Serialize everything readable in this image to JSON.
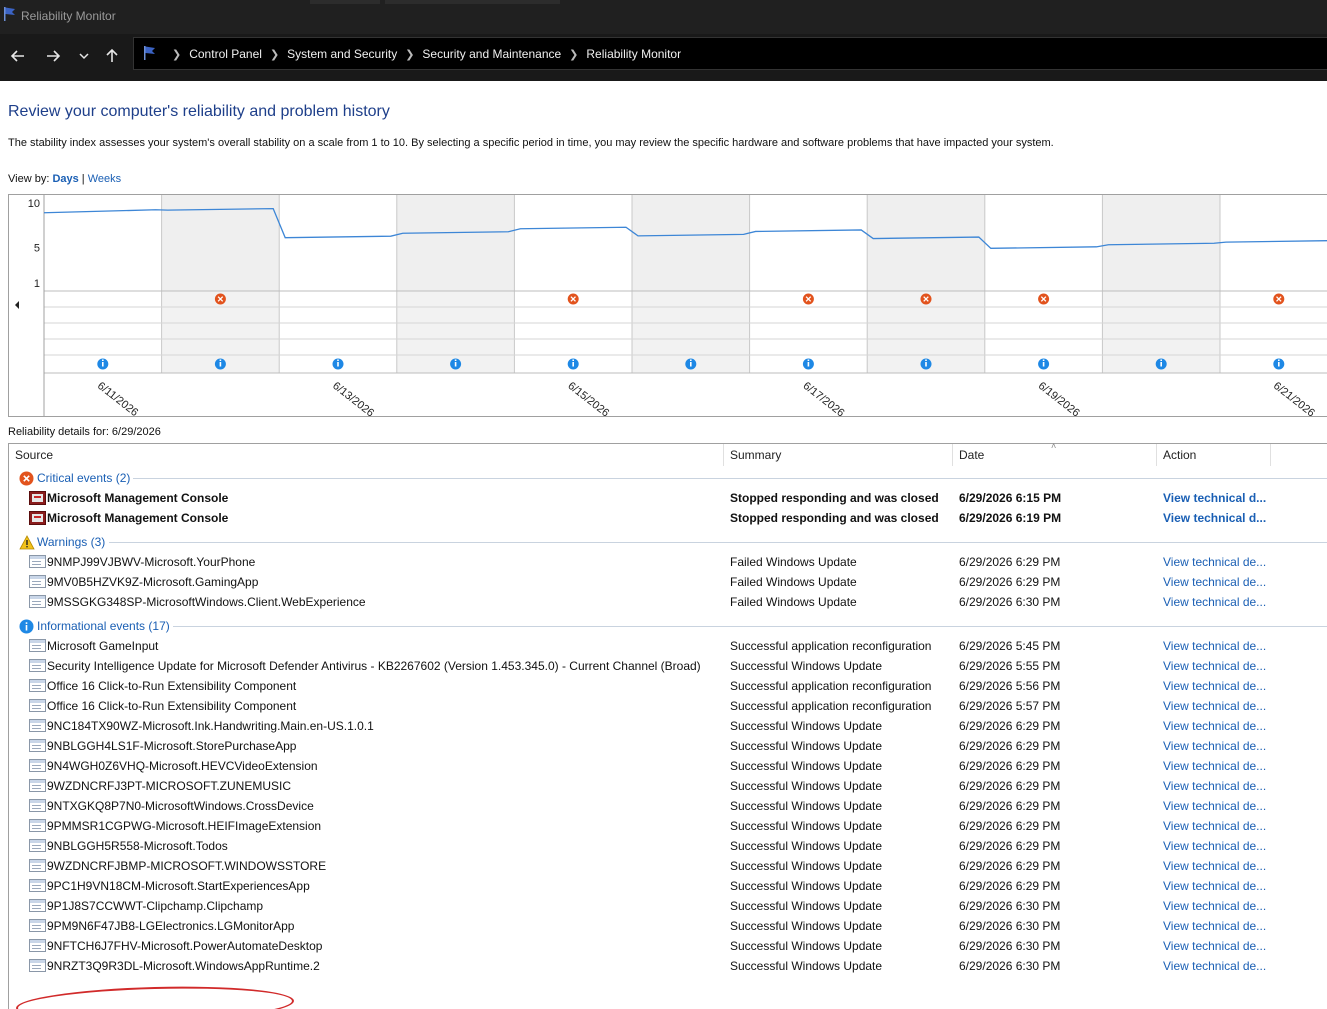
{
  "window": {
    "title": "Reliability Monitor"
  },
  "breadcrumbs": [
    "Control Panel",
    "System and Security",
    "Security and Maintenance",
    "Reliability Monitor"
  ],
  "heading": "Review your computer's reliability and problem history",
  "description": "The stability index assesses your system's overall stability on a scale from 1 to 10. By selecting a specific period in time, you may review the specific hardware and software problems that have impacted your system.",
  "view_by": {
    "label": "View by:",
    "days": "Days",
    "separator": "|",
    "weeks": "Weeks"
  },
  "chart_data": {
    "type": "line",
    "title": "",
    "y_ticks": [
      "10",
      "5",
      "1"
    ],
    "ylim": [
      1,
      10
    ],
    "date_labels": [
      "6/11/2026",
      "6/13/2026",
      "6/15/2026",
      "6/17/2026",
      "6/19/2026",
      "6/21/2026"
    ],
    "x": [
      "6/11/2026",
      "6/12/2026",
      "6/13/2026",
      "6/14/2026",
      "6/15/2026",
      "6/16/2026",
      "6/17/2026",
      "6/18/2026",
      "6/19/2026",
      "6/20/2026",
      "6/21/2026"
    ],
    "stability": [
      8.9,
      9.2,
      6.1,
      6.6,
      7.1,
      6.3,
      6.8,
      6.0,
      4.9,
      5.3,
      5.6
    ],
    "critical_events_days": [
      "6/12/2026",
      "6/15/2026",
      "6/17/2026",
      "6/18/2026",
      "6/19/2026",
      "6/21/2026"
    ],
    "informational_events_days": [
      "6/11/2026",
      "6/12/2026",
      "6/13/2026",
      "6/14/2026",
      "6/15/2026",
      "6/16/2026",
      "6/17/2026",
      "6/18/2026",
      "6/19/2026",
      "6/20/2026",
      "6/21/2026"
    ],
    "shaded_weekend_columns": true
  },
  "details_label": "Reliability details for: 6/29/2026",
  "columns": {
    "source": "Source",
    "summary": "Summary",
    "date": "Date",
    "action": "Action"
  },
  "groups": [
    {
      "kind": "critical",
      "label": "Critical events (2)",
      "rows": [
        {
          "source": "Microsoft Management Console",
          "summary": "Stopped responding and was closed",
          "date": "6/29/2026 6:15 PM",
          "action": "View technical d..."
        },
        {
          "source": "Microsoft Management Console",
          "summary": "Stopped responding and was closed",
          "date": "6/29/2026 6:19 PM",
          "action": "View technical d..."
        }
      ]
    },
    {
      "kind": "warning",
      "label": "Warnings (3)",
      "rows": [
        {
          "source": "9NMPJ99VJBWV-Microsoft.YourPhone",
          "summary": "Failed Windows Update",
          "date": "6/29/2026 6:29 PM",
          "action": "View technical de..."
        },
        {
          "source": "9MV0B5HZVK9Z-Microsoft.GamingApp",
          "summary": "Failed Windows Update",
          "date": "6/29/2026 6:29 PM",
          "action": "View technical de..."
        },
        {
          "source": "9MSSGKG348SP-MicrosoftWindows.Client.WebExperience",
          "summary": "Failed Windows Update",
          "date": "6/29/2026 6:30 PM",
          "action": "View technical de..."
        }
      ]
    },
    {
      "kind": "info",
      "label": "Informational events (17)",
      "rows": [
        {
          "source": "Microsoft GameInput",
          "summary": "Successful application reconfiguration",
          "date": "6/29/2026 5:45 PM",
          "action": "View technical de..."
        },
        {
          "source": "Security Intelligence Update for Microsoft Defender Antivirus - KB2267602 (Version 1.453.345.0) - Current Channel (Broad)",
          "summary": "Successful Windows Update",
          "date": "6/29/2026 5:55 PM",
          "action": "View technical de..."
        },
        {
          "source": "Office 16 Click-to-Run Extensibility Component",
          "summary": "Successful application reconfiguration",
          "date": "6/29/2026 5:56 PM",
          "action": "View technical de..."
        },
        {
          "source": "Office 16 Click-to-Run Extensibility Component",
          "summary": "Successful application reconfiguration",
          "date": "6/29/2026 5:57 PM",
          "action": "View technical de..."
        },
        {
          "source": "9NC184TX90WZ-Microsoft.Ink.Handwriting.Main.en-US.1.0.1",
          "summary": "Successful Windows Update",
          "date": "6/29/2026 6:29 PM",
          "action": "View technical de..."
        },
        {
          "source": "9NBLGGH4LS1F-Microsoft.StorePurchaseApp",
          "summary": "Successful Windows Update",
          "date": "6/29/2026 6:29 PM",
          "action": "View technical de..."
        },
        {
          "source": "9N4WGH0Z6VHQ-Microsoft.HEVCVideoExtension",
          "summary": "Successful Windows Update",
          "date": "6/29/2026 6:29 PM",
          "action": "View technical de..."
        },
        {
          "source": "9WZDNCRFJ3PT-MICROSOFT.ZUNEMUSIC",
          "summary": "Successful Windows Update",
          "date": "6/29/2026 6:29 PM",
          "action": "View technical de..."
        },
        {
          "source": "9NTXGKQ8P7N0-MicrosoftWindows.CrossDevice",
          "summary": "Successful Windows Update",
          "date": "6/29/2026 6:29 PM",
          "action": "View technical de..."
        },
        {
          "source": "9PMMSR1CGPWG-Microsoft.HEIFImageExtension",
          "summary": "Successful Windows Update",
          "date": "6/29/2026 6:29 PM",
          "action": "View technical de..."
        },
        {
          "source": "9NBLGGH5R558-Microsoft.Todos",
          "summary": "Successful Windows Update",
          "date": "6/29/2026 6:29 PM",
          "action": "View technical de..."
        },
        {
          "source": "9WZDNCRFJBMP-MICROSOFT.WINDOWSSTORE",
          "summary": "Successful Windows Update",
          "date": "6/29/2026 6:29 PM",
          "action": "View technical de..."
        },
        {
          "source": "9PC1H9VN18CM-Microsoft.StartExperiencesApp",
          "summary": "Successful Windows Update",
          "date": "6/29/2026 6:29 PM",
          "action": "View technical de..."
        },
        {
          "source": "9P1J8S7CCWWT-Clipchamp.Clipchamp",
          "summary": "Successful Windows Update",
          "date": "6/29/2026 6:30 PM",
          "action": "View technical de..."
        },
        {
          "source": "9PM9N6F47JB8-LGElectronics.LGMonitorApp",
          "summary": "Successful Windows Update",
          "date": "6/29/2026 6:30 PM",
          "action": "View technical de...",
          "highlighted": true
        },
        {
          "source": "9NFTCH6J7FHV-Microsoft.PowerAutomateDesktop",
          "summary": "Successful Windows Update",
          "date": "6/29/2026 6:30 PM",
          "action": "View technical de..."
        },
        {
          "source": "9NRZT3Q9R3DL-Microsoft.WindowsAppRuntime.2",
          "summary": "Successful Windows Update",
          "date": "6/29/2026 6:30 PM",
          "action": "View technical de..."
        }
      ]
    }
  ],
  "colors": {
    "link": "#1a5fb4",
    "heading": "#1e3f8a",
    "chart_line": "#3d86d6",
    "critical": "#e2531d",
    "info": "#1e88e5",
    "highlight_circle": "#d12a2a"
  },
  "icons": {
    "app": "app-window-icon",
    "mmc": "mmc-icon",
    "critical": "error-icon",
    "warning": "warning-icon",
    "info": "info-icon"
  }
}
